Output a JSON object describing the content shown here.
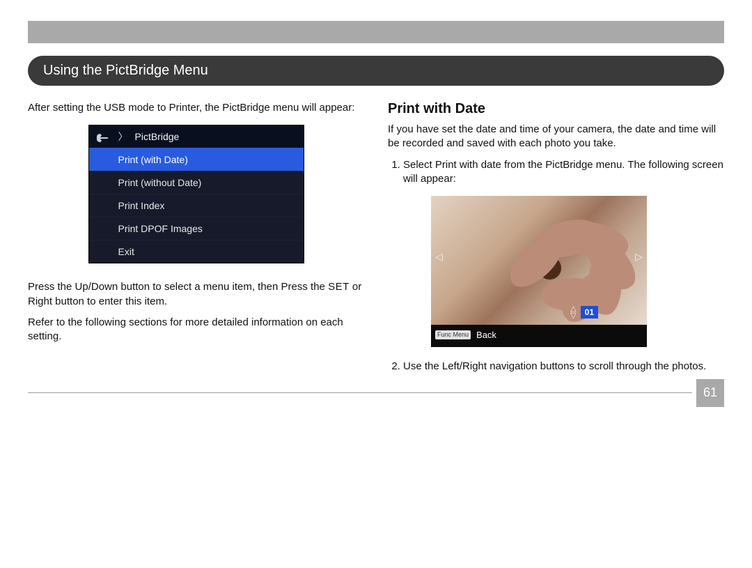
{
  "header": {
    "section_title": "Using the PictBridge Menu"
  },
  "left": {
    "intro": "After setting the USB mode to Printer, the PictBridge menu will appear:",
    "menu_title": "PictBridge",
    "menu_items": [
      "Print (with Date)",
      "Print (without Date)",
      "Print Index",
      "Print DPOF Images",
      "Exit"
    ],
    "instruction_pre": "Press the Up/Down button to select a menu item, then Press the ",
    "set_label": "SET",
    "instruction_post": " or Right button to enter this item.",
    "more_info": "Refer to the following sections for more detailed information on each setting."
  },
  "right": {
    "title": "Print with Date",
    "intro": "If you have set the date and time of your camera, the date and time will be recorded and saved with each photo you take.",
    "steps": [
      "Select Print with date from the PictBridge menu. The following screen will appear:",
      "Use the Left/Right navigation buttons to scroll through the photos."
    ],
    "preview": {
      "counter": "01",
      "back_label": "Back",
      "funcmenu_chip": "Func Menu"
    }
  },
  "page_number": "61"
}
